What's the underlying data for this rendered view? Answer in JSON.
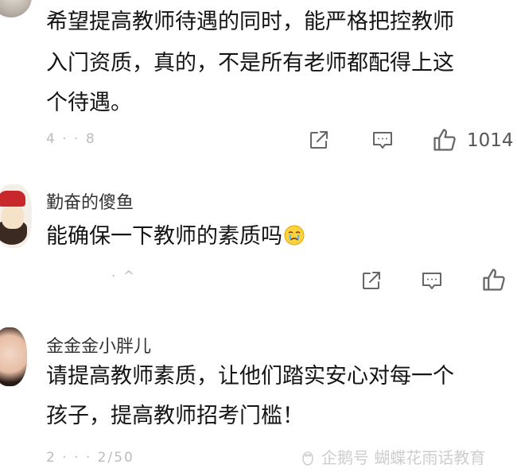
{
  "comments": [
    {
      "lines": [
        "希望提高教师待遇的同时，能严格把控教师",
        "入门资质，真的，不是所有老师都配得上这",
        "个待遇。"
      ],
      "time": "4 · · 8",
      "like_count": "1014"
    },
    {
      "username": "勤奋的傻鱼",
      "text": "能确保一下教师的素质吗",
      "emoji": "crying-face",
      "time": "· ^"
    },
    {
      "username": "金金金小胖儿",
      "lines": [
        "请提高教师素质，让他们踏实安心对每一个",
        "孩子，提高教师招考门槛！"
      ],
      "time": "2 · · · 2/50"
    }
  ],
  "watermark": "企鹅号 蝴蝶花雨话教育",
  "icons": [
    "share-icon",
    "comment-icon",
    "like-icon"
  ],
  "colors": {
    "text": "#141414",
    "username": "#333333",
    "meta": "#bdbdbd",
    "icon": "#666666"
  }
}
